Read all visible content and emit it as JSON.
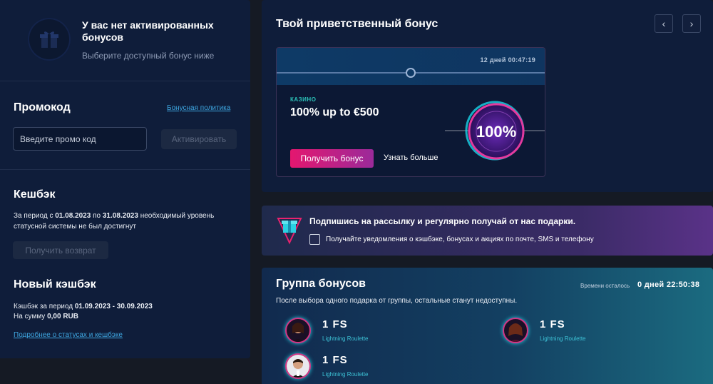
{
  "no_bonus": {
    "title": "У вас нет активированных бонусов",
    "subtitle": "Выберите доступный бонус ниже",
    "icon": "gift-icon"
  },
  "promo": {
    "title": "Промокод",
    "policy_link": "Бонусная политика",
    "input_placeholder": "Введите промо код",
    "activate_label": "Активировать"
  },
  "cashback": {
    "title": "Кешбэк",
    "text_prefix": "За период с ",
    "date_from": "01.08.2023",
    "text_mid": " по ",
    "date_to": "31.08.2023",
    "text_suffix": " необходимый уровень статусной системы не был достигнут",
    "button_label": "Получить возврат"
  },
  "new_cashback": {
    "title": "Новый кэшбэк",
    "period_label": "Кэшбэк за период ",
    "period_value": "01.09.2023 - 30.09.2023",
    "sum_label": "На сумму ",
    "sum_value": "0,00 RUB",
    "link": "Подробнее о статусах и кешбэке"
  },
  "welcome": {
    "title": "Твой приветственный бонус",
    "prev_icon": "chevron-left-icon",
    "next_icon": "chevron-right-icon",
    "card": {
      "timer": "12 дней 00:47:19",
      "category": "КАЗИНО",
      "title": "100% up to €500",
      "badge": "100%",
      "get_button": "Получить бонус",
      "learn_more": "Узнать больше"
    }
  },
  "subscribe": {
    "title": "Подпишись на рассылку и регулярно получай от нас подарки.",
    "checkbox_label": "Получайте уведомления о кэшбэке, бонусах и акциях по почте, SMS и телефону",
    "checked": false
  },
  "group": {
    "title": "Группа бонусов",
    "remaining_label": "Времени осталось",
    "remaining_value": "0 дней 22:50:38",
    "subtitle": "После выбора одного подарка от группы, остальные станут недоступны.",
    "items": [
      {
        "value": "1 FS",
        "game": "Lightning Roulette"
      },
      {
        "value": "1 FS",
        "game": "Lightning Roulette"
      },
      {
        "value": "1 FS",
        "game": "Lightning Roulette"
      }
    ]
  },
  "colors": {
    "panel": "#0f1d3a",
    "accent_pink": "#e4176f",
    "link_blue": "#3ea6e0",
    "teal": "#2bc1b8"
  }
}
